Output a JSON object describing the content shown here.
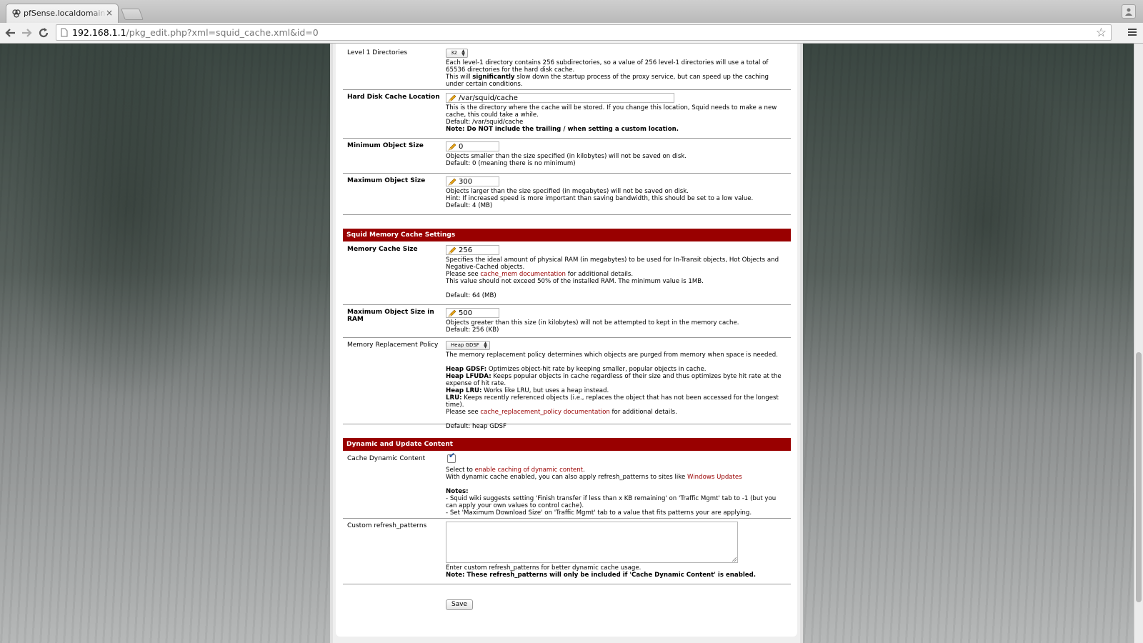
{
  "browser": {
    "tab_title": "pfSense.localdomain - Pro",
    "tab_close": "×",
    "url_host": "192.168.1.1",
    "url_path": "/pkg_edit.php?xml=squid_cache.xml&id=0"
  },
  "level1": {
    "label": "Level 1 Directories",
    "value": "32",
    "desc1": "Each level-1 directory contains 256 subdirectories, so a value of 256 level-1 directories will use a total of 65536 directories for the hard disk cache.",
    "desc2_pre": "This will ",
    "desc2_bold": "significantly",
    "desc2_post": " slow down the startup process of the proxy service, but can speed up the caching under certain conditions."
  },
  "hdd_location": {
    "label": "Hard Disk Cache Location",
    "value": "/var/squid/cache",
    "desc1": "This is the directory where the cache will be stored. If you change this location, Squid needs to make a new cache, this could take a while.",
    "desc2": "Default: /var/squid/cache",
    "note": "Note: Do NOT include the trailing / when setting a custom location."
  },
  "min_object": {
    "label": "Minimum Object Size",
    "value": "0",
    "desc1": "Objects smaller than the size specified (in kilobytes) will not be saved on disk.",
    "desc2": "Default: 0 (meaning there is no minimum)"
  },
  "max_object": {
    "label": "Maximum Object Size",
    "value": "300",
    "desc1": "Objects larger than the size specified (in megabytes) will not be saved on disk.",
    "desc2": "Hint: If increased speed is more important than saving bandwidth, this should be set to a low value.",
    "desc3": "Default: 4 (MB)"
  },
  "section_memory": "Squid Memory Cache Settings",
  "memory_cache": {
    "label": "Memory Cache Size",
    "value": "256",
    "desc1": "Specifies the ideal amount of physical RAM (in megabytes) to be used for In-Transit objects, Hot Objects and Negative-Cached objects.",
    "see_pre": "Please see ",
    "see_link": "cache_mem documentation",
    "see_post": " for additional details.",
    "desc3": "This value should not exceed 50% of the installed RAM. The minimum value is 1MB.",
    "desc4": "Default: 64 (MB)"
  },
  "max_object_ram": {
    "label": "Maximum Object Size in RAM",
    "value": "500",
    "desc1": "Objects greater than this size (in kilobytes) will not be attempted to kept in the memory cache.",
    "desc2": "Default: 256 (KB)"
  },
  "replacement": {
    "label": "Memory Replacement Policy",
    "value": "Heap GDSF",
    "desc1": "The memory replacement policy determines which objects are purged from memory when space is needed.",
    "gdsf_b": "Heap GDSF:",
    "gdsf": " Optimizes object-hit rate by keeping smaller, popular objects in cache.",
    "lfuda_b": "Heap LFUDA:",
    "lfuda": " Keeps popular objects in cache regardless of their size and thus optimizes byte hit rate at the expense of hit rate.",
    "lru_heap_b": "Heap LRU:",
    "lru_heap": " Works like LRU, but uses a heap instead.",
    "lru_b": "LRU:",
    "lru": " Keeps recently referenced objects (i.e., replaces the object that has not been accessed for the longest time).",
    "see_pre": "Please see ",
    "see_link": "cache_replacement_policy documentation",
    "see_post": " for additional details.",
    "default": "Default: heap GDSF"
  },
  "section_dynamic": "Dynamic and Update Content",
  "dynamic": {
    "label": "Cache Dynamic Content",
    "checked_glyph": "✔",
    "line1_pre": "Select to ",
    "line1_link": "enable caching of dynamic content",
    "line1_post": ".",
    "line2_pre": "With dynamic cache enabled, you can also apply refresh_patterns to sites like ",
    "line2_link": "Windows Updates",
    "notes_title": "Notes:",
    "note1": "- Squid wiki suggests setting 'Finish transfer if less than x KB remaining' on 'Traffic Mgmt' tab to -1 (but you can apply your own values to control cache).",
    "note2": "- Set 'Maximum Download Size' on 'Traffic Mgmt' tab to a value that fits patterns your are applying."
  },
  "refresh": {
    "label": "Custom refresh_patterns",
    "desc1": "Enter custom refresh_patterns for better dynamic cache usage.",
    "note": "Note: These refresh_patterns will only be included if 'Cache Dynamic Content' is enabled."
  },
  "save_label": "Save"
}
